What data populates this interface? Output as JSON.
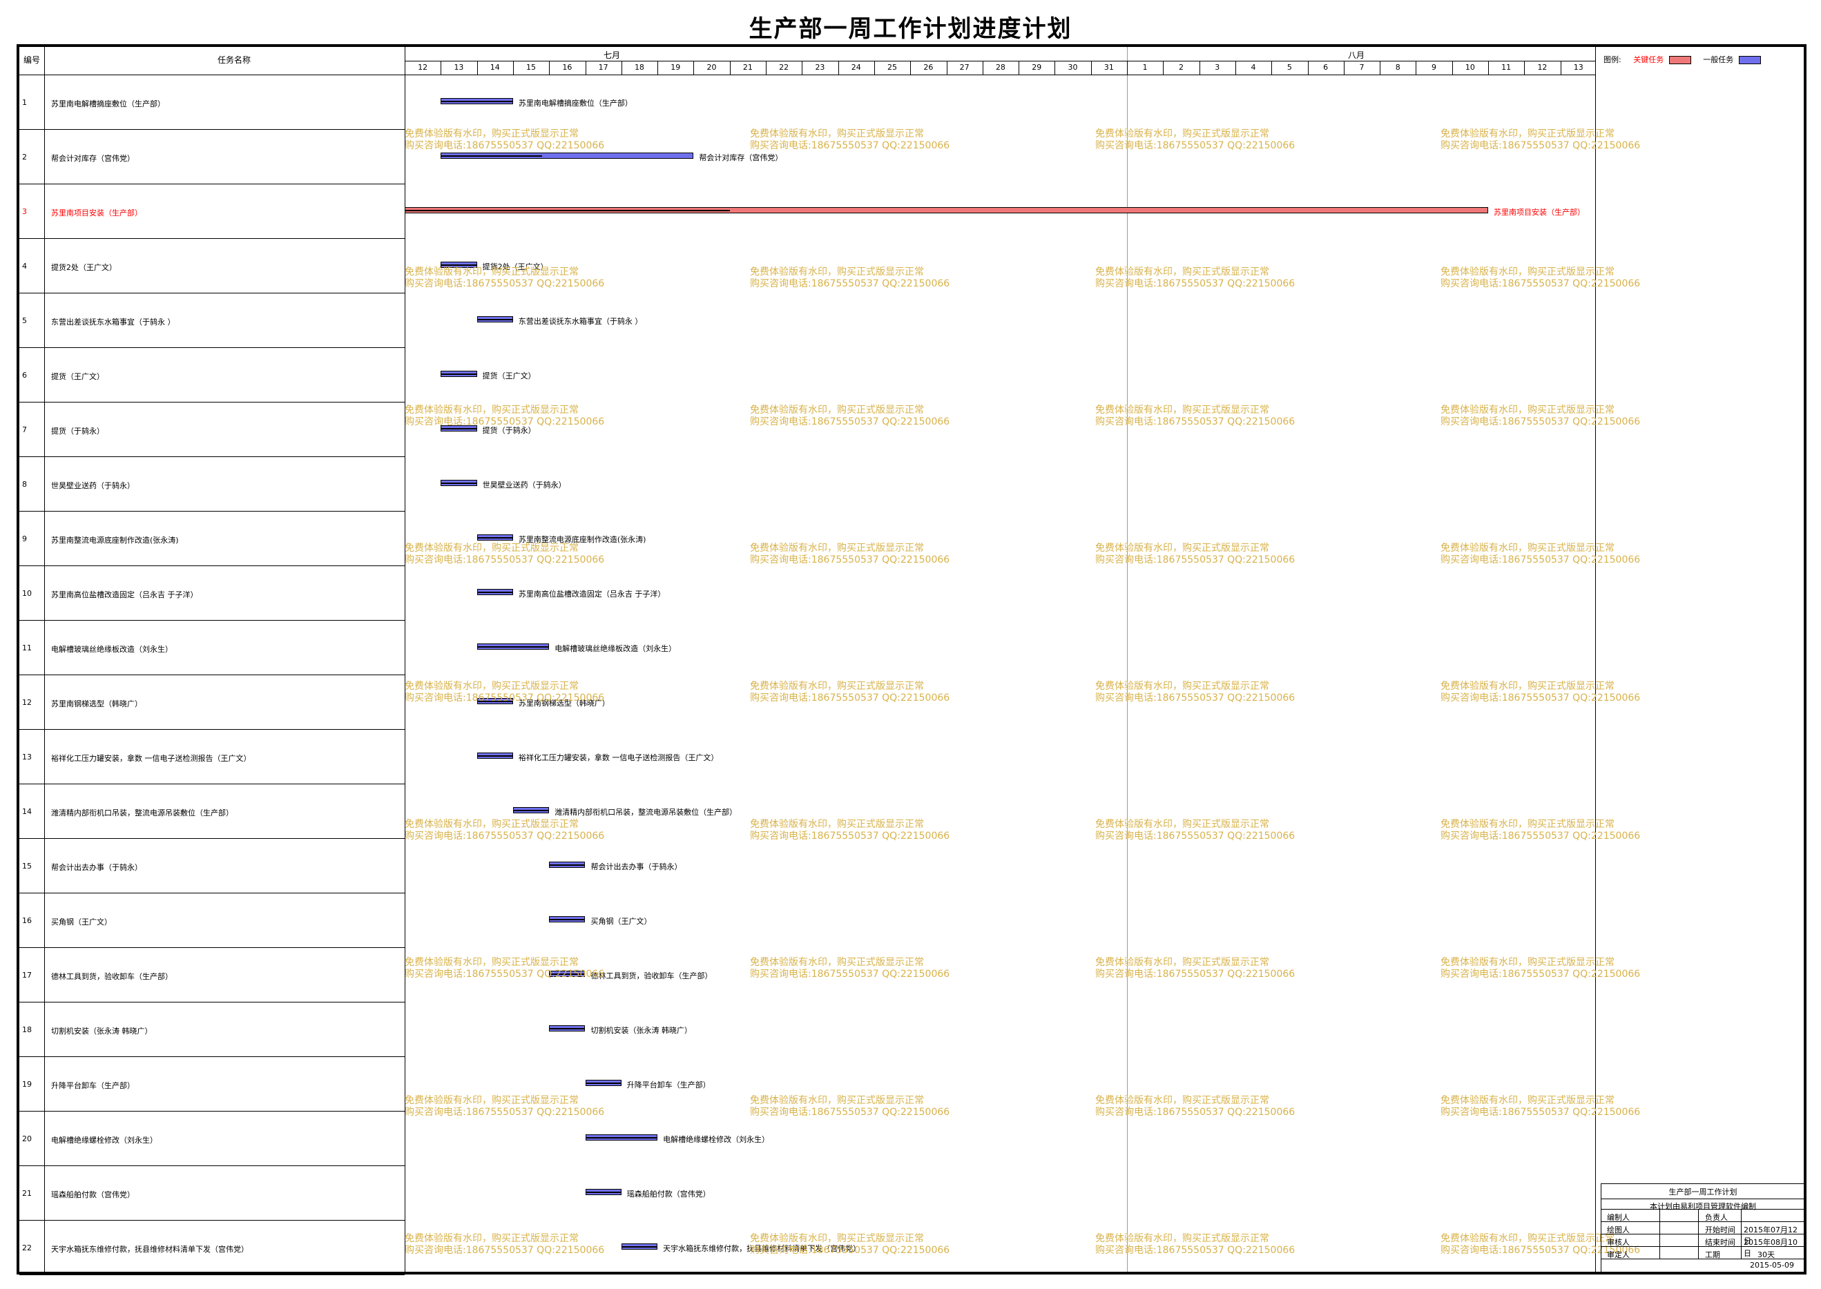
{
  "title": "生产部一周工作计划进度计划",
  "header": {
    "col_no": "编号",
    "col_name": "任务名称",
    "month1": "七月",
    "month2": "八月"
  },
  "days": [
    "12",
    "13",
    "14",
    "15",
    "16",
    "17",
    "18",
    "19",
    "20",
    "21",
    "22",
    "23",
    "24",
    "25",
    "26",
    "27",
    "28",
    "29",
    "30",
    "31",
    "1",
    "2",
    "3",
    "4",
    "5",
    "6",
    "7",
    "8",
    "9",
    "10",
    "11",
    "12",
    "13"
  ],
  "legend": {
    "label": "图例:",
    "critical": "关键任务",
    "normal": "一般任务",
    "critical_color": "#f07878",
    "normal_color": "#7070ee"
  },
  "colors": {
    "critical": "#f07878",
    "normal": "#7070ee",
    "critical_text": "#ff0000",
    "watermark": "#d8b24a"
  },
  "tasks": [
    {
      "no": "1",
      "name": "苏里南电解槽摘座敷位（生产部）",
      "start": 13,
      "dur": 2,
      "prog": 1.0,
      "critical": false
    },
    {
      "no": "2",
      "name": "帮会计对库存（宫伟党）",
      "start": 13,
      "dur": 7,
      "prog": 0.4,
      "critical": false
    },
    {
      "no": "3",
      "name": "苏里南项目安装（生产部）",
      "start": 12,
      "dur": 30,
      "prog": 0.3,
      "critical": true
    },
    {
      "no": "4",
      "name": "提货2处（王广文）",
      "start": 13,
      "dur": 1,
      "prog": 1.0,
      "critical": false
    },
    {
      "no": "5",
      "name": "东营出差谈抚东水箱事宜（于鸫永 ）",
      "start": 14,
      "dur": 1,
      "prog": 1.0,
      "critical": false
    },
    {
      "no": "6",
      "name": "提货（王广文）",
      "start": 13,
      "dur": 1,
      "prog": 1.0,
      "critical": false
    },
    {
      "no": "7",
      "name": "提货（于鸫永）",
      "start": 13,
      "dur": 1,
      "prog": 1.0,
      "critical": false
    },
    {
      "no": "8",
      "name": "世昊壁业送药（于鸫永）",
      "start": 13,
      "dur": 1,
      "prog": 1.0,
      "critical": false
    },
    {
      "no": "9",
      "name": "苏里南整流电源底座制作改造(张永涛)",
      "start": 14,
      "dur": 1,
      "prog": 1.0,
      "critical": false
    },
    {
      "no": "10",
      "name": "苏里南高位盐槽改造固定（吕永吉 于子洋）",
      "start": 14,
      "dur": 1,
      "prog": 1.0,
      "critical": false
    },
    {
      "no": "11",
      "name": "电解槽玻璃丝绝缘板改造（刘永生）",
      "start": 14,
      "dur": 2,
      "prog": 1.0,
      "critical": false
    },
    {
      "no": "12",
      "name": "苏里南钢梯选型（韩晓广）",
      "start": 14,
      "dur": 1,
      "prog": 1.0,
      "critical": false
    },
    {
      "no": "13",
      "name": "裕祥化工压力罐安装，拿数 一信电子送检测报告（王广文）",
      "start": 14,
      "dur": 1,
      "prog": 1.0,
      "critical": false
    },
    {
      "no": "14",
      "name": "潍清精内部衔机口吊装，整流电源吊装敷位（生产部）",
      "start": 15,
      "dur": 1,
      "prog": 1.0,
      "critical": false
    },
    {
      "no": "15",
      "name": "帮会计出去办事（于鸫永）",
      "start": 16,
      "dur": 1,
      "prog": 1.0,
      "critical": false
    },
    {
      "no": "16",
      "name": "买角钢（王广文）",
      "start": 16,
      "dur": 1,
      "prog": 1.0,
      "critical": false
    },
    {
      "no": "17",
      "name": "德林工具到货，验收卸车（生产部）",
      "start": 16,
      "dur": 1,
      "prog": 1.0,
      "critical": false
    },
    {
      "no": "18",
      "name": "切割机安装（张永涛 韩晓广）",
      "start": 16,
      "dur": 1,
      "prog": 1.0,
      "critical": false
    },
    {
      "no": "19",
      "name": "升降平台卸车（生产部）",
      "start": 17,
      "dur": 1,
      "prog": 1.0,
      "critical": false
    },
    {
      "no": "20",
      "name": "电解槽绝缘螺栓修改（刘永生）",
      "start": 17,
      "dur": 2,
      "prog": 1.0,
      "critical": false
    },
    {
      "no": "21",
      "name": "瑶森船舶付款（宫伟党）",
      "start": 17,
      "dur": 1,
      "prog": 1.0,
      "critical": false
    },
    {
      "no": "22",
      "name": "天宇水箱抚东维修付款，抚县维修材料清单下发（宫伟党）",
      "start": 18,
      "dur": 1,
      "prog": 1.0,
      "critical": false
    }
  ],
  "watermark": {
    "line1": "免费体验版有水印，购买正式版显示正常",
    "line2": "购买咨询电话:18675550537 QQ:22150066"
  },
  "titleblock": {
    "title": "生产部一周工作计划",
    "note": "本计划由易利项目管理软件编制",
    "r1c1": "编制人",
    "r1c3": "负责人",
    "r2c1": "绘图人",
    "r2c3": "开始时间",
    "r2c4": "2015年07月12日",
    "r3c1": "审核人",
    "r3c3": "结束时间",
    "r3c4": "2015年08月10日",
    "r4c1": "审定人",
    "r4c3": "工期",
    "r4c4": "30天",
    "date": "2015-05-09"
  }
}
